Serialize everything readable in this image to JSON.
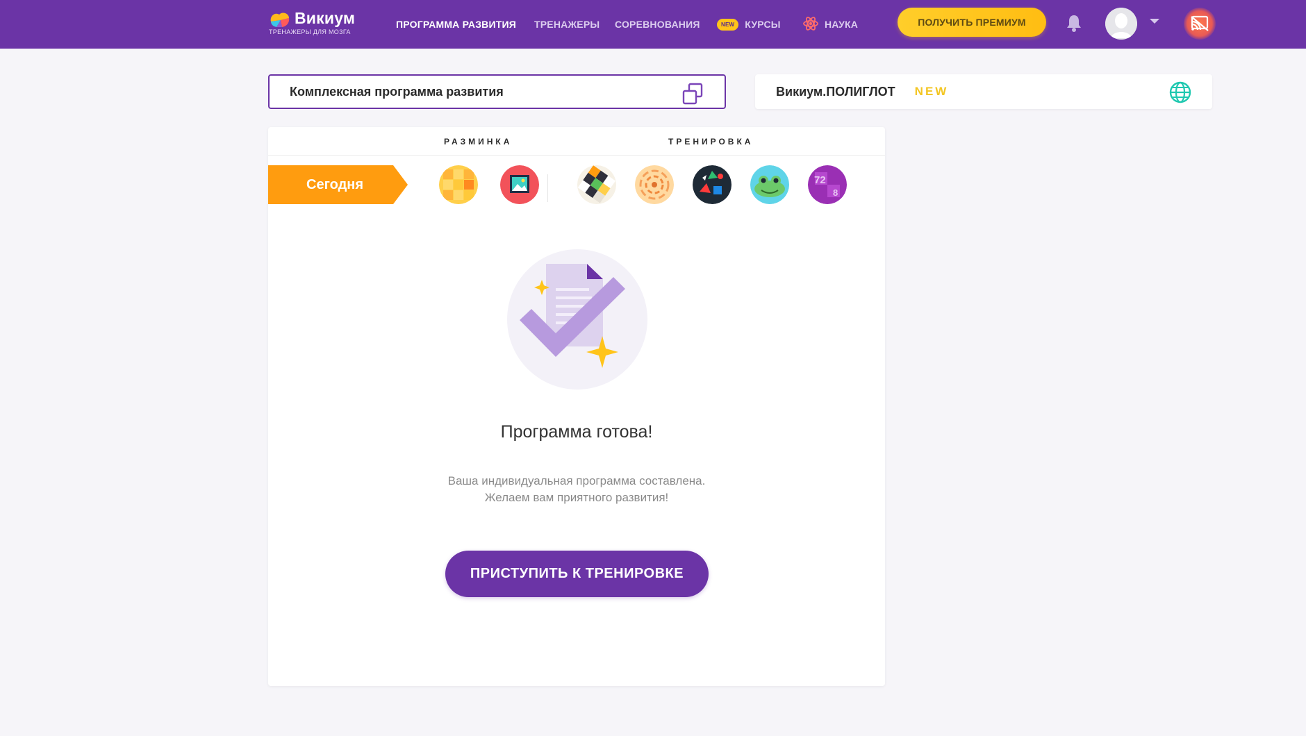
{
  "header": {
    "logo_name": "Викиум",
    "logo_subtitle": "ТРЕНАЖЕРЫ ДЛЯ МОЗГА",
    "nav": {
      "program": "ПРОГРАММА РАЗВИТИЯ",
      "trainers": "ТРЕНАЖЕРЫ",
      "competitions": "СОРЕВНОВАНИЯ",
      "courses_badge": "NEW",
      "courses": "КУРСЫ",
      "science": "НАУКА"
    },
    "premium_label": "ПОЛУЧИТЬ ПРЕМИУМ",
    "icons": [
      "logo-icon",
      "atom-icon",
      "bell-icon",
      "avatar",
      "caret-down-icon",
      "cast-icon"
    ]
  },
  "program_selector": {
    "label": "Комплексная программа развития",
    "icon": "copy-icon"
  },
  "polyglot": {
    "label": "Викиум.ПОЛИГЛОТ",
    "badge": "NEW",
    "icon": "globe-icon"
  },
  "card": {
    "warmup_label": "РАЗМИНКА",
    "training_label": "ТРЕНИРОВКА",
    "today_label": "Сегодня",
    "warmup_games": [
      "game-yellow-grid-icon",
      "game-red-picture-icon"
    ],
    "training_games": [
      "game-checker-icon",
      "game-spiral-icon",
      "game-dark-shapes-icon",
      "game-frog-icon",
      "game-numbers-icon"
    ],
    "numbers_game_text_1": "72",
    "numbers_game_text_2": "8",
    "ready_title": "Программа готова!",
    "ready_desc_line1": "Ваша индивидуальная программа составлена.",
    "ready_desc_line2": "Желаем вам приятного развития!",
    "start_button": "ПРИСТУПИТЬ К ТРЕНИРОВКЕ"
  },
  "colors": {
    "brand_purple": "#6b34a6",
    "premium_yellow": "#ffc41a",
    "today_orange": "#ff9c0f",
    "globe_teal": "#1fc8b0"
  }
}
